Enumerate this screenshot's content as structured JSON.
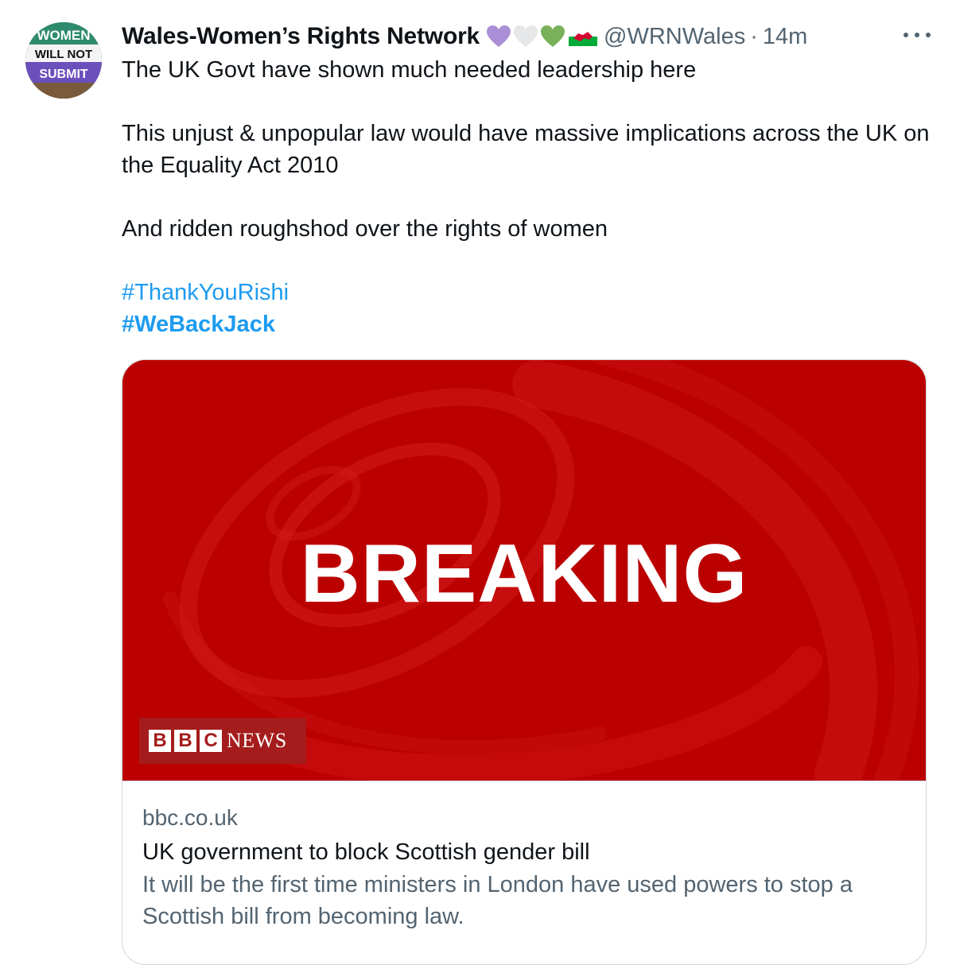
{
  "tweet": {
    "display_name": "Wales-Women’s Rights Network",
    "emoji_icons": [
      "purple-heart-icon",
      "white-heart-icon",
      "green-heart-icon",
      "wales-flag-icon"
    ],
    "handle": "@WRNWales",
    "separator": "·",
    "time": "14m",
    "avatar_text": [
      "WOMEN",
      "WILL NOT",
      "SUBMIT"
    ],
    "lines": [
      "The UK Govt have shown much needed leadership here",
      "This unjust & unpopular law would have massive implications across the UK on the Equality Act 2010",
      "And ridden roughshod over the rights of women"
    ],
    "hashtags": [
      "#ThankYouRishi",
      "#WeBackJack"
    ]
  },
  "card": {
    "image_headline": "BREAKING",
    "logo_letters": [
      "B",
      "B",
      "C"
    ],
    "logo_word": "NEWS",
    "domain": "bbc.co.uk",
    "title": "UK government to block Scottish gender bill",
    "description": "It will be the first time ministers in London have used powers to stop a Scottish bill from becoming law."
  },
  "colors": {
    "text": "#0f1419",
    "secondary": "#536471",
    "link": "#1d9bf0",
    "bbc_red": "#bb0000",
    "purple_heart": "#a98fd8",
    "green_heart": "#78b159"
  }
}
